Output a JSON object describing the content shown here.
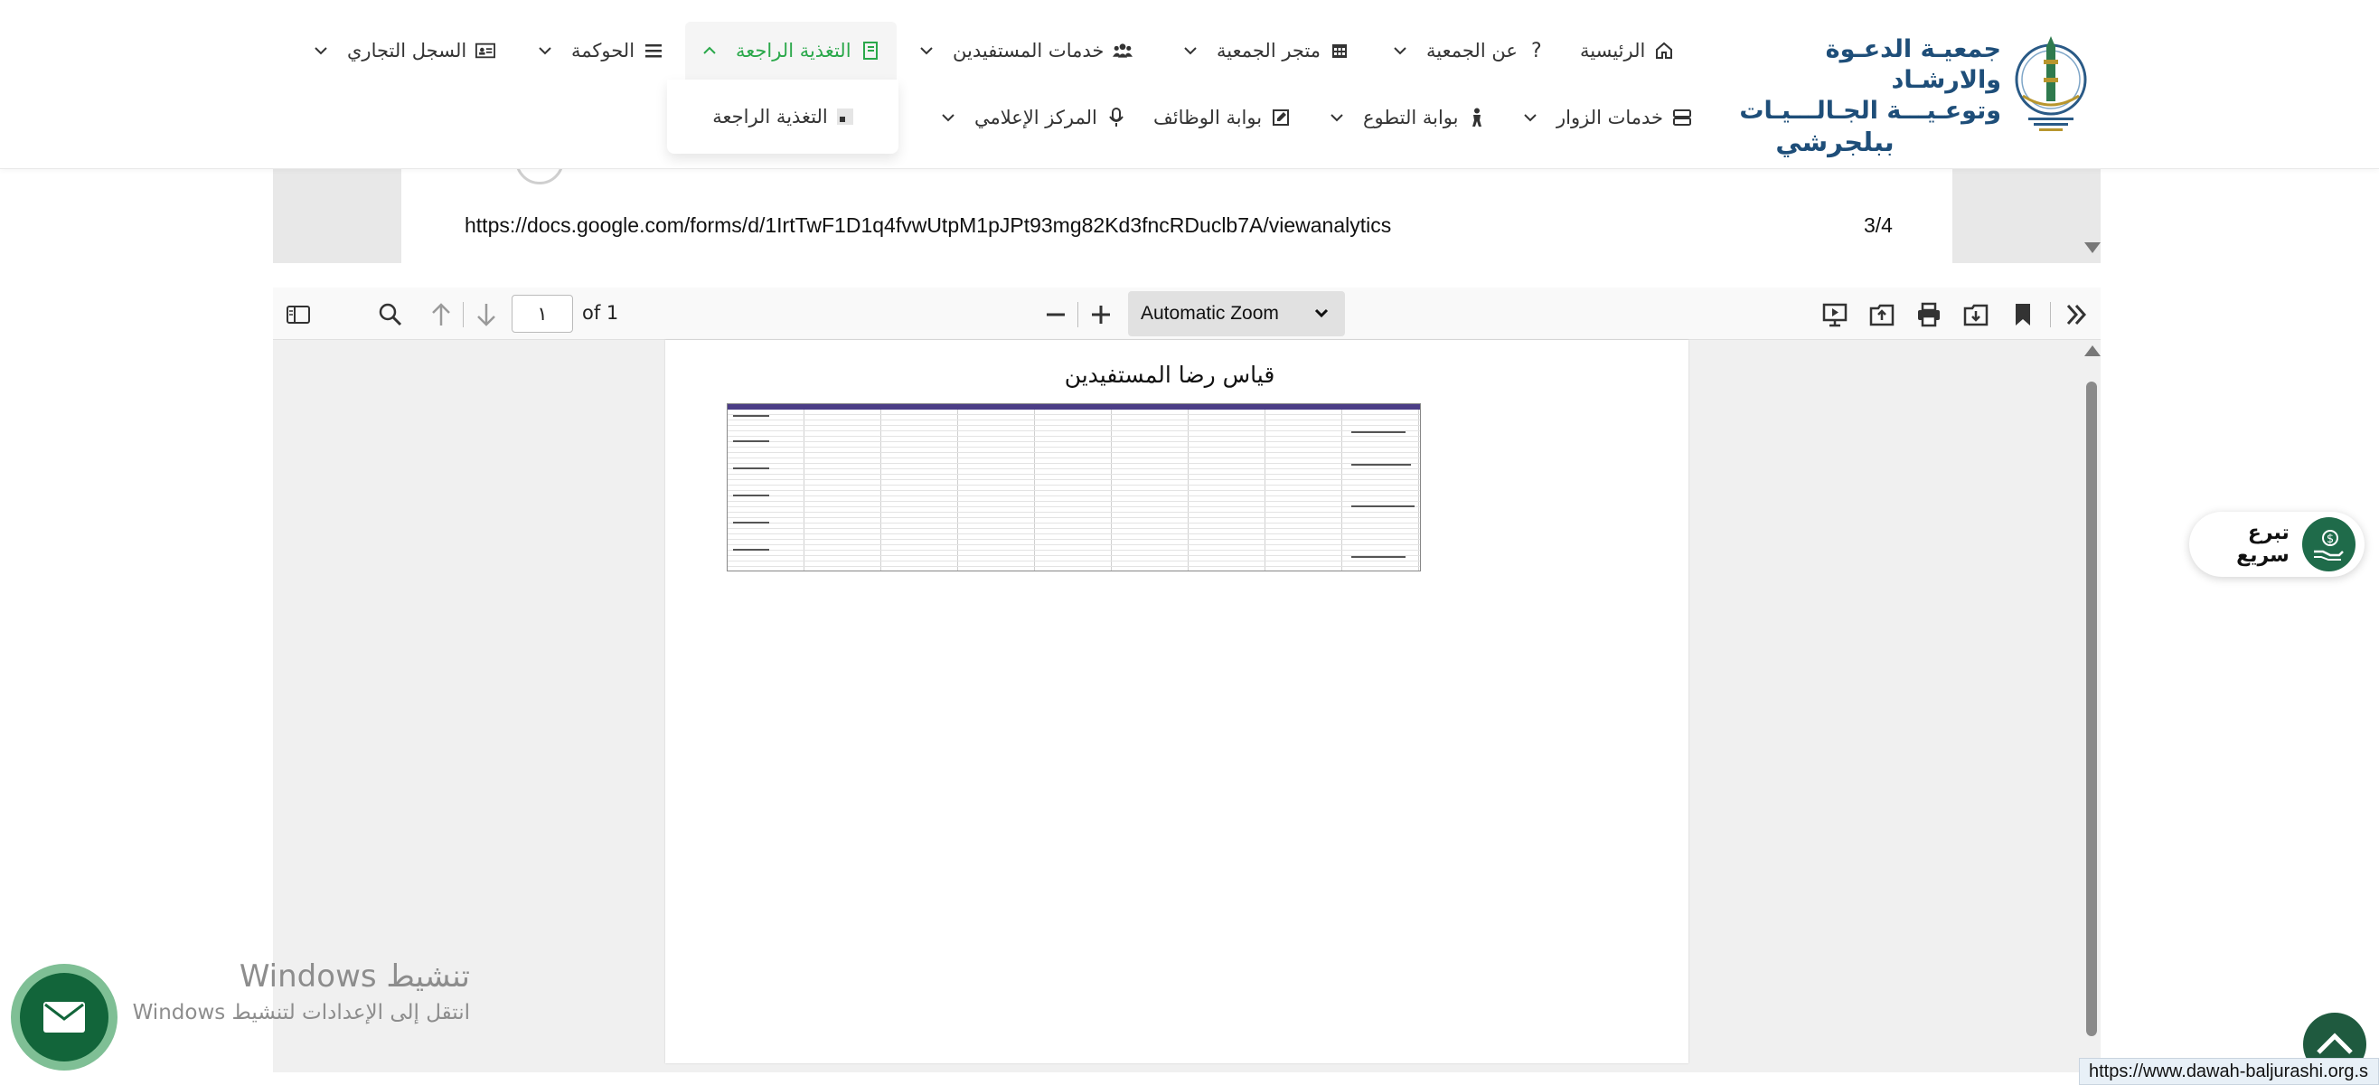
{
  "header": {
    "org_name_line1": "جمعيـة الدعـوة والارشـاد",
    "org_name_line2": "وتوعـيـــة الجـالـــيـات",
    "org_name_line3": "ببلجرشي",
    "nav_row1": [
      {
        "label": "الرئيسية",
        "icon": "home-icon"
      },
      {
        "label": "عن الجمعية",
        "icon": "question-icon"
      },
      {
        "label": "متجر الجمعية",
        "icon": "calendar-icon"
      },
      {
        "label": "خدمات المستفيدين",
        "icon": "users-icon"
      },
      {
        "label": "التغذية الراجعة",
        "icon": "book-icon"
      },
      {
        "label": "الحوكمة",
        "icon": "menu-icon"
      },
      {
        "label": "السجل التجاري",
        "icon": "id-card-icon"
      }
    ],
    "nav_row2": [
      {
        "label": "خدمات الزوار",
        "icon": "server-icon"
      },
      {
        "label": "بوابة التطوع",
        "icon": "person-icon"
      },
      {
        "label": "بوابة الوظائف",
        "icon": "edit-icon"
      },
      {
        "label": "المركز الإعلامي",
        "icon": "microphone-icon"
      }
    ],
    "active_item": "التغذية الراجعة",
    "dropdown_items": [
      "التغذية الراجعة"
    ],
    "accent_color": "#2aa84a",
    "brand_color": "#1e4e79"
  },
  "upper_page": {
    "url": "https://docs.google.com/forms/d/1IrtTwF1D1q4fvwUtpM1pJPt93mg82Kd3fncRDuclb7A/viewanalytics",
    "page_count": "3/4"
  },
  "pdf_viewer": {
    "page_number": "١",
    "page_total_label": "of 1",
    "zoom_label": "Automatic Zoom",
    "document_title": "قياس رضا المستفيدين"
  },
  "floating": {
    "quick_donate_label": "تبرع سريع",
    "donate_color": "#1f6b4a",
    "windows_activation_title": "تنشيط Windows",
    "windows_activation_subtitle": "انتقل إلى الإعدادات لتنشيط Windows",
    "status_bar_url": "https://www.dawah-baljurashi.org.s"
  }
}
